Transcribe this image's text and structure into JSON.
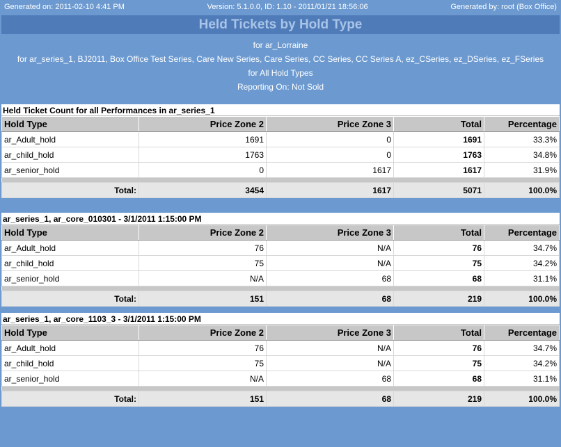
{
  "header": {
    "generated": "Generated on: 2011-02-10 4:41 PM",
    "version": "Version: 5.1.0.0, ID: 1.10 - 2011/01/21 18:56:06",
    "generated_by": "Generated by: root (Box Office)",
    "title": "Held Tickets by Hold Type"
  },
  "params": {
    "for_user": "for ar_Lorraine",
    "series": "for ar_series_1, BJ2011, Box Office Test Series, Care New Series, Care Series, CC Series, CC Series A, ez_CSeries, ez_DSeries, ez_FSeries",
    "hold_types": "for All Hold Types",
    "reporting": "Reporting On: Not Sold"
  },
  "columns": [
    "Hold Type",
    "Price Zone 2",
    "Price Zone 3",
    "Total",
    "Percentage"
  ],
  "sections": [
    {
      "title": "Held Ticket Count for all Performances in ar_series_1",
      "rows": [
        [
          "ar_Adult_hold",
          "1691",
          "0",
          "1691",
          "33.3%"
        ],
        [
          "ar_child_hold",
          "1763",
          "0",
          "1763",
          "34.8%"
        ],
        [
          "ar_senior_hold",
          "0",
          "1617",
          "1617",
          "31.9%"
        ]
      ],
      "total": [
        "Total:",
        "3454",
        "1617",
        "5071",
        "100.0%"
      ]
    },
    {
      "title": "ar_series_1, ar_core_010301 - 3/1/2011 1:15:00 PM",
      "rows": [
        [
          "ar_Adult_hold",
          "76",
          "N/A",
          "76",
          "34.7%"
        ],
        [
          "ar_child_hold",
          "75",
          "N/A",
          "75",
          "34.2%"
        ],
        [
          "ar_senior_hold",
          "N/A",
          "68",
          "68",
          "31.1%"
        ]
      ],
      "total": [
        "Total:",
        "151",
        "68",
        "219",
        "100.0%"
      ]
    },
    {
      "title": "ar_series_1, ar_core_1103_3 - 3/1/2011 1:15:00 PM",
      "rows": [
        [
          "ar_Adult_hold",
          "76",
          "N/A",
          "76",
          "34.7%"
        ],
        [
          "ar_child_hold",
          "75",
          "N/A",
          "75",
          "34.2%"
        ],
        [
          "ar_senior_hold",
          "N/A",
          "68",
          "68",
          "31.1%"
        ]
      ],
      "total": [
        "Total:",
        "151",
        "68",
        "219",
        "100.0%"
      ]
    }
  ]
}
